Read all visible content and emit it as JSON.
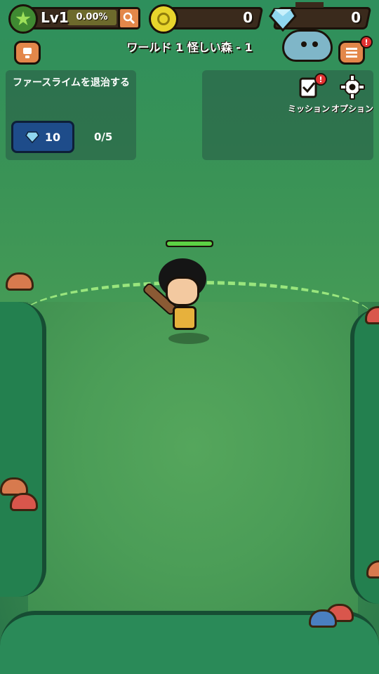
{
  "top_bar": {
    "level_label": "Lv1",
    "xp_percent": "0.00%",
    "coins": "0",
    "gems": "0"
  },
  "world": {
    "title": "ワールド 1 怪しい森 - 1"
  },
  "quest": {
    "text": "ファースライムを退治する",
    "reward_gems": "10",
    "progress": "0/5"
  },
  "menu": {
    "mission_label": "ミッション",
    "option_label": "オプション"
  },
  "alerts": {
    "menu_alert": "!",
    "mission_alert": "!"
  },
  "hero": {
    "hp_fraction": 1.0
  },
  "colors": {
    "hp_green": "#5cd244",
    "button_orange": "#e3874a",
    "reward_blue": "#1e4c8a"
  },
  "icons": [
    "star-icon",
    "search-icon",
    "coin-icon",
    "gem-icon",
    "notice-icon",
    "menu-icon",
    "mission-icon",
    "gear-icon"
  ]
}
